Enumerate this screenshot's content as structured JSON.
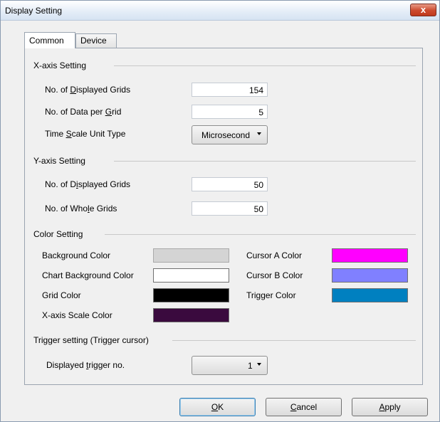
{
  "window": {
    "title": "Display Setting",
    "close_label": "x"
  },
  "tabs": [
    {
      "label": "Common"
    },
    {
      "label": "Device"
    }
  ],
  "x_axis": {
    "title": "X-axis Setting",
    "displayed_grids": {
      "label_pre": "No. of ",
      "label_u": "D",
      "label_post": "isplayed Grids",
      "value": "154"
    },
    "data_per_grid": {
      "label_pre": "No. of Data per ",
      "label_u": "G",
      "label_post": "rid",
      "value": "5"
    },
    "time_scale": {
      "label_pre": "Time ",
      "label_u": "S",
      "label_post": "cale Unit Type",
      "value": "Microsecond"
    }
  },
  "y_axis": {
    "title": "Y-axis Setting",
    "displayed_grids": {
      "label_pre": "No. of D",
      "label_u": "i",
      "label_post": "splayed Grids",
      "value": "50"
    },
    "whole_grids": {
      "label_pre": "No. of Who",
      "label_u": "l",
      "label_post": "e Grids",
      "value": "50"
    }
  },
  "color_setting": {
    "title": "Color Setting",
    "background": {
      "label": "Background Color",
      "color": "#d4d4d4"
    },
    "chart_background": {
      "label": "Chart Background Color",
      "color": "#ffffff"
    },
    "grid": {
      "label": "Grid Color",
      "color": "#000000"
    },
    "x_axis_scale": {
      "label": "X-axis Scale Color",
      "color": "#3a0a3e"
    },
    "cursor_a": {
      "label": "Cursor A Color",
      "color": "#ff00ff"
    },
    "cursor_b": {
      "label": "Cursor B Color",
      "color": "#8080ff"
    },
    "trigger": {
      "label": "Trigger Color",
      "color": "#0080c0"
    }
  },
  "trigger_setting": {
    "title": "Trigger setting (Trigger cursor)",
    "displayed_trigger": {
      "label_pre": "Displayed ",
      "label_u": "t",
      "label_post": "rigger no.",
      "value": "1"
    }
  },
  "buttons": {
    "ok": {
      "label_u": "O",
      "label_post": "K"
    },
    "cancel": {
      "label_u": "C",
      "label_post": "ancel"
    },
    "apply": {
      "label_u": "A",
      "label_post": "pply"
    }
  }
}
